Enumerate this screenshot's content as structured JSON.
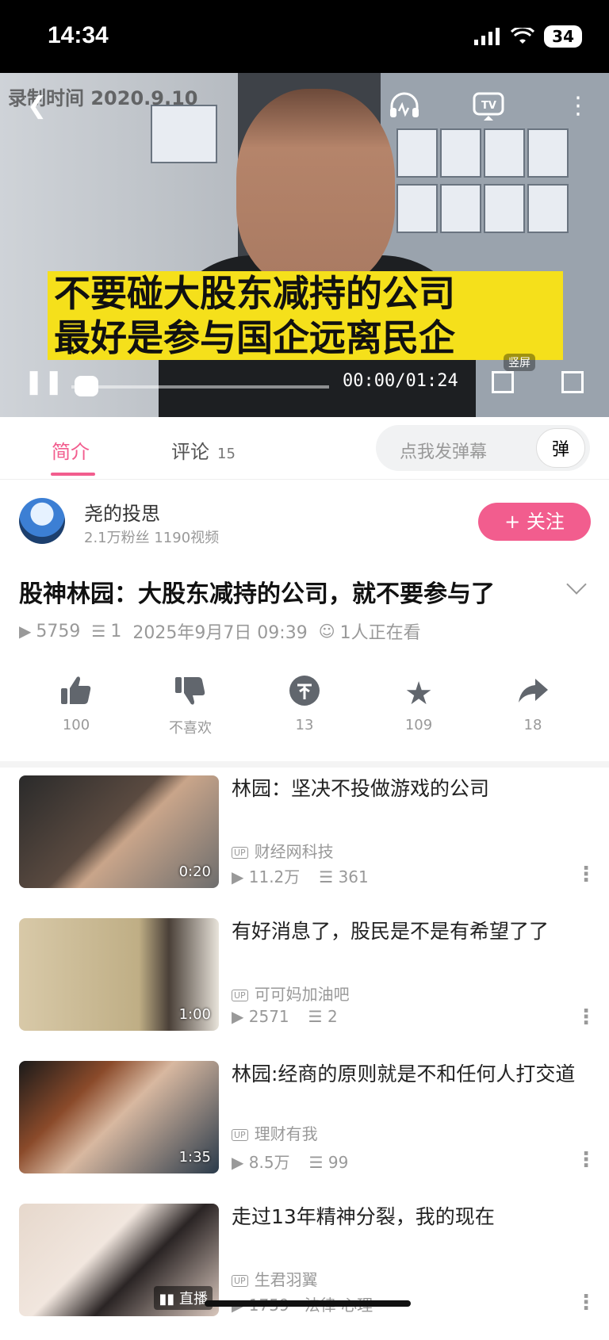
{
  "status_bar": {
    "time": "14:34",
    "battery": "34"
  },
  "video": {
    "record_time": "录制时间 2020.9.10",
    "subtitle_line1": "不要碰大股东减持的公司",
    "subtitle_line2": "最好是参与国企远离民企",
    "time_readout": "00:00/01:24",
    "vertical_label": "竖屏"
  },
  "tabs": {
    "intro": "简介",
    "comments": "评论",
    "comments_count": "15",
    "danmaku_placeholder": "点我发弹幕",
    "danmaku_button": "弹"
  },
  "uploader": {
    "name": "尧的投思",
    "meta": "2.1万粉丝  1190视频",
    "follow_label": "+ 关注"
  },
  "video_info": {
    "title": "股神林园：大股东减持的公司，就不要参与了",
    "views": "5759",
    "danmaku": "1",
    "date": "2025年9月7日 09:39",
    "watching": "1人正在看"
  },
  "actions": {
    "like": "100",
    "dislike": "不喜欢",
    "coin": "13",
    "favorite": "109",
    "share": "18"
  },
  "recommendations": [
    {
      "title": "林园：坚决不投做游戏的公司",
      "uploader": "财经网科技",
      "views": "11.2万",
      "danmaku": "361",
      "duration": "0:20"
    },
    {
      "title": "有好消息了，股民是不是有希望了了",
      "uploader": "可可妈加油吧",
      "views": "2571",
      "danmaku": "2",
      "duration": "1:00"
    },
    {
      "title": "林园:经商的原则就是不和任何人打交道",
      "uploader": "理财有我",
      "views": "8.5万",
      "danmaku": "99",
      "duration": "1:35"
    },
    {
      "title": "走过13年精神分裂，我的现在",
      "uploader": "生君羽翼",
      "views": "1759",
      "tags": "法律·心理",
      "badge": "直播"
    }
  ],
  "colors": {
    "accent": "#f25d8e",
    "subtitle_bg": "#f5e01b"
  }
}
